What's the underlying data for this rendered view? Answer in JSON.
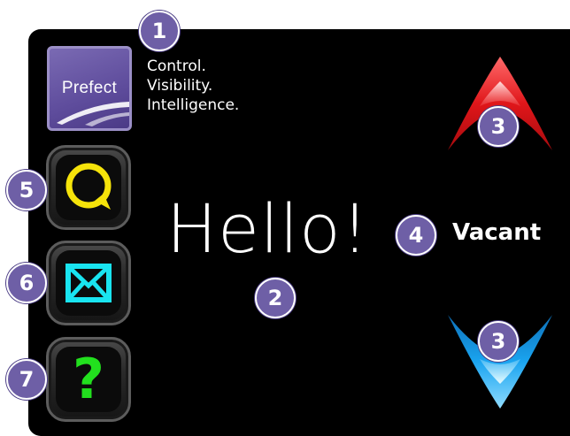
{
  "brand": {
    "logo_text": "Prefect",
    "tagline": [
      "Control.",
      "Visibility.",
      "Intelligence."
    ],
    "color": "#6e5fa6"
  },
  "greeting": "Hello!",
  "status": {
    "label": "Vacant"
  },
  "buttons": {
    "chat": {
      "icon": "chat-bubble-icon",
      "color": "#f5e30a"
    },
    "mail": {
      "icon": "envelope-icon",
      "color": "#19e4f0"
    },
    "help": {
      "icon": "question-mark-icon",
      "glyph": "?",
      "color": "#22e01e"
    }
  },
  "arrows": {
    "up": {
      "icon": "chevron-up-icon",
      "color": "#e0161a"
    },
    "down": {
      "icon": "chevron-down-icon",
      "color": "#1aa4f0"
    }
  },
  "callouts": {
    "logo": "1",
    "greeting": "2",
    "arrow_up": "3",
    "arrow_down": "3",
    "status": "4",
    "chat": "5",
    "mail": "6",
    "help": "7"
  }
}
